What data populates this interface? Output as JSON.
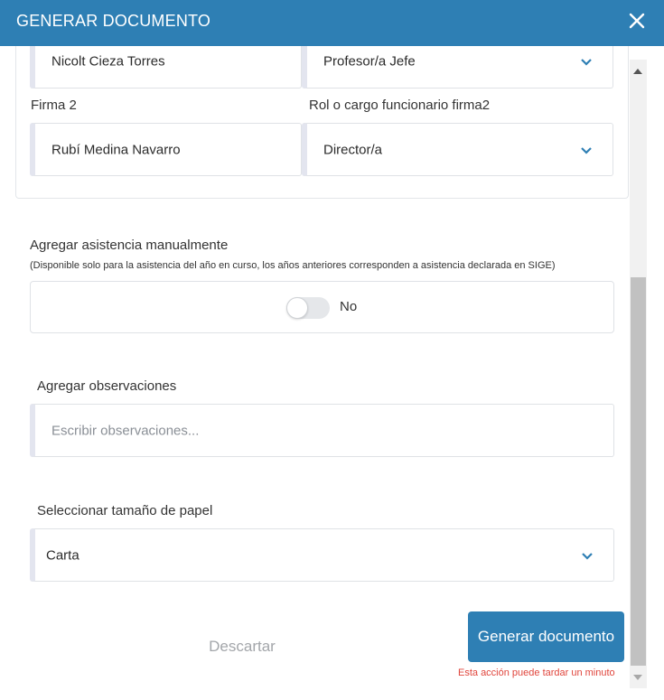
{
  "header": {
    "title": "GENERAR DOCUMENTO",
    "close_icon": "close-icon"
  },
  "signatures": {
    "firma1_value": "Nicolt Cieza Torres",
    "rol1_value": "Profesor/a Jefe",
    "firma2_label": "Firma 2",
    "firma2_value": "Rubí Medina Navarro",
    "rol2_label": "Rol o cargo funcionario firma2",
    "rol2_value": "Director/a"
  },
  "attendance": {
    "label": "Agregar asistencia manualmente",
    "note": "(Disponible solo para la asistencia del año en curso, los años anteriores corresponden a asistencia declarada en SIGE)",
    "toggle_state": "No"
  },
  "observations": {
    "label": "Agregar observaciones",
    "placeholder": "Escribir observaciones..."
  },
  "paper": {
    "label": "Seleccionar tamaño de papel",
    "value": "Carta"
  },
  "actions": {
    "discard_label": "Descartar",
    "generate_label": "Generar documento",
    "warning": "Esta acción puede tardar un minuto"
  },
  "colors": {
    "brand": "#2e7fb4",
    "warning": "#e0453c",
    "chevron": "#2e7fb4"
  }
}
